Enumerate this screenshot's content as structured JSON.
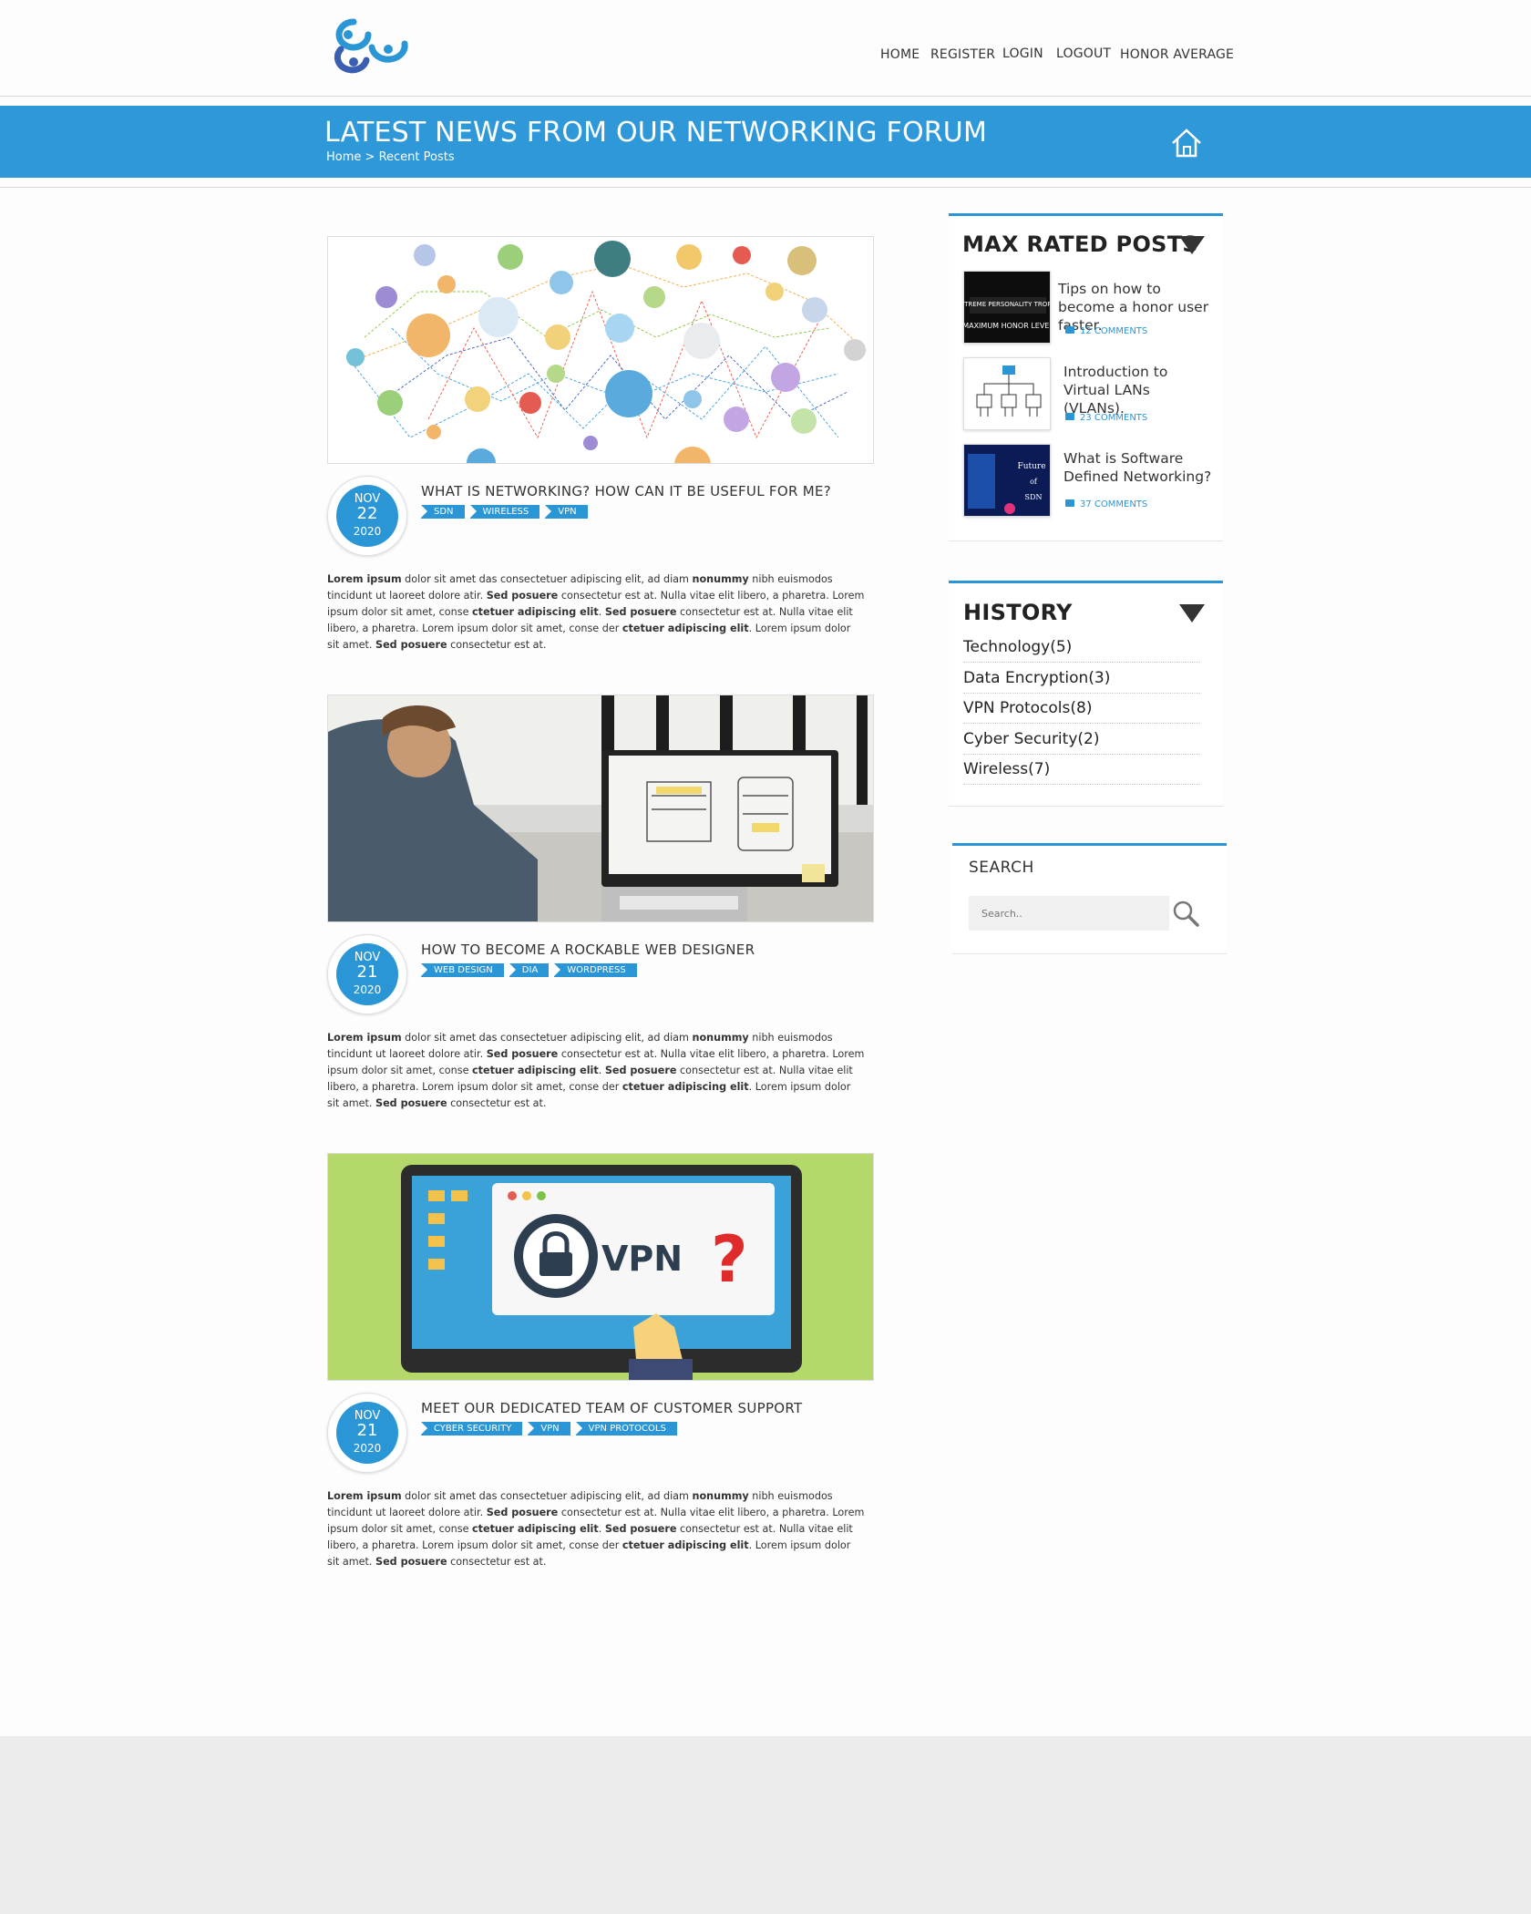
{
  "nav": [
    "HOME",
    "REGISTER",
    "LOGIN",
    "LOGOUT",
    "HONOR AVERAGE"
  ],
  "banner": {
    "title": "LATEST NEWS FROM OUR NETWORKING FORUM",
    "crumb_home": "Home",
    "crumb_sep": ">",
    "crumb_current": "Recent Posts"
  },
  "posts": [
    {
      "month": "NOV",
      "day": "22",
      "year": "2020",
      "title": "WHAT IS NETWORKING? HOW CAN IT BE USEFUL FOR ME?",
      "tags": [
        "SDN",
        "WIRELESS",
        "VPN"
      ]
    },
    {
      "month": "NOV",
      "day": "21",
      "year": "2020",
      "title": "HOW TO BECOME A ROCKABLE WEB DESIGNER",
      "tags": [
        "WEB DESIGN",
        "DIA",
        "WORDPRESS"
      ]
    },
    {
      "month": "NOV",
      "day": "21",
      "year": "2020",
      "title": "MEET OUR DEDICATED TEAM OF CUSTOMER SUPPORT",
      "tags": [
        "CYBER SECURITY",
        "VPN",
        "VPN PROTOCOLS"
      ]
    }
  ],
  "body_text": {
    "s1": "Lorem ipsum",
    "s2": " dolor sit amet das consectetuer adipiscing elit, ad diam ",
    "s3": "nonummy",
    "s4": " nibh euismodos tincidunt ut laoreet dolore atir. ",
    "s5": "Sed posuere",
    "s6": " consectetur  est at. Nulla vitae elit libero, a pharetra. Lorem ipsum dolor sit amet, conse ",
    "s7": "ctetuer adipiscing elit",
    "s8": ". ",
    "s9": "Sed posuere",
    "s10": "  consectetur  est at. Nulla vitae elit libero, a pharetra. Lorem ipsum dolor  sit amet, conse der ",
    "s11": "ctetuer adipiscing elit",
    "s12": ". Lorem ipsum dolor sit amet. ",
    "s13": "Sed posuere",
    "s14": " consectetur  est at."
  },
  "sidebar": {
    "max_rated": {
      "title": "MAX RATED POSTS",
      "items": [
        {
          "title": "Tips on how to become a honor user faster.",
          "comments": "12 COMMENTS",
          "thumb_text_1": "EXTREME PERSONALITY TROPHY",
          "thumb_text_2": "MAXIMUM HONOR LEVEL"
        },
        {
          "title": "Introduction to Virtual LANs (VLANs).",
          "comments": "23 COMMENTS"
        },
        {
          "title": "What is Software Defined Networking?",
          "comments": "37 COMMENTS",
          "thumb_text_1": "Future",
          "thumb_text_2": "of",
          "thumb_text_3": "SDN"
        }
      ]
    },
    "history": {
      "title": "HISTORY",
      "items": [
        "Technology(5)",
        "Data Encryption(3)",
        "VPN Protocols(8)",
        "Cyber Security(2)",
        "Wireless(7)"
      ]
    },
    "search": {
      "label": "SEARCH",
      "placeholder": "Search.."
    }
  },
  "images": {
    "vpn_label": "VPN",
    "question": "?"
  },
  "colors": {
    "accent": "#2a96d6",
    "banner": "#2f98d9"
  }
}
